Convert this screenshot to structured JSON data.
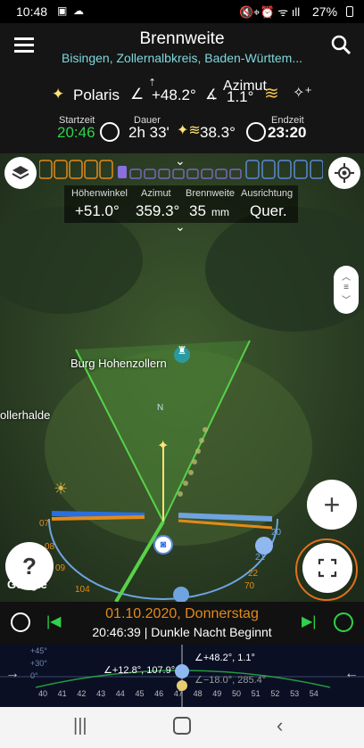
{
  "status": {
    "time": "10:48",
    "battery": "27%"
  },
  "header": {
    "title": "Brennweite",
    "subtitle": "Bisingen, Zollernalbkreis, Baden-Württem...",
    "star": "Polaris",
    "elev_label": "Höhenwinkel",
    "elev_value": "+48.2°",
    "azimut_label": "Azimut",
    "azimut_value": "1.1°",
    "start_label": "Startzeit",
    "start_value": "20:46",
    "duration_label": "Dauer",
    "duration_value": "2h 33'",
    "arc_value": "38.3°",
    "end_label": "Endzeit",
    "end_value": "23:20"
  },
  "panel": {
    "elev_label": "Höhenwinkel",
    "elev_value": "+51.0°",
    "azimut_label": "Azimut",
    "azimut_value": "359.3°",
    "focal_label": "Brennweite",
    "focal_value": "35",
    "focal_unit": "mm",
    "orient_label": "Ausrichtung",
    "orient_value": "Quer."
  },
  "map": {
    "castle": "Burg Hohenzollern",
    "place": "ollerhalde",
    "north": "N",
    "google": "Google",
    "labels": [
      "07",
      "08",
      "09",
      "10",
      "104",
      "11",
      "12",
      "20",
      "21",
      "22",
      "70"
    ]
  },
  "date": {
    "line1": "01.10.2020, Donnerstag",
    "line2": "20:46:39 | Dunkle Nacht Beginnt"
  },
  "timeline": {
    "label_top": "∠+48.2°, 1.1°",
    "label_mid": "∠+12.8°, 107.9°",
    "label_low": "∠−18.0°, 285.4°",
    "alts": [
      "+45°",
      "+30°",
      "+15°",
      "0°",
      "-15°"
    ],
    "ticks": [
      "40",
      "41",
      "42",
      "43",
      "44",
      "45",
      "46",
      "47",
      "48",
      "49",
      "50",
      "51",
      "52",
      "53",
      "54"
    ]
  },
  "colors": {
    "accent": "#e38a1a",
    "green": "#2fd24a",
    "cyan": "#7fd8dd"
  }
}
